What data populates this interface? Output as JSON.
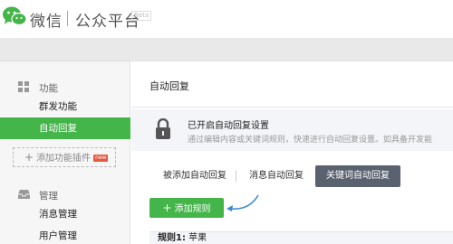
{
  "header": {
    "brand": "微信",
    "platform": "公众平台",
    "badge": "Beta"
  },
  "sidebar": {
    "groups": [
      {
        "label": "功能",
        "icon": "grid-icon"
      },
      {
        "label": "管理",
        "icon": "inbox-icon"
      }
    ],
    "items": [
      {
        "label": "群发功能"
      },
      {
        "label": "自动回复",
        "active": true
      },
      {
        "label": "消息管理"
      },
      {
        "label": "用户管理"
      }
    ],
    "add_plugin": {
      "label": "添加功能插件",
      "badge": "new"
    }
  },
  "main": {
    "title": "自动回复",
    "notice": {
      "title": "已开启自动回复设置",
      "desc": "通过编辑内容或关键词规则，快速进行自动回复设置。如具备开发能"
    },
    "tabs": [
      {
        "label": "被添加自动回复"
      },
      {
        "label": "消息自动回复"
      },
      {
        "label": "关键词自动回复",
        "active": true
      }
    ],
    "add_rule_label": "添加规则",
    "rule": {
      "name": "规则1:",
      "value": "苹果"
    }
  },
  "colors": {
    "accent_green": "#44b549",
    "active_tab": "#5a6270",
    "annotation_arrow": "#3b8bd4",
    "new_badge": "#e75840"
  }
}
